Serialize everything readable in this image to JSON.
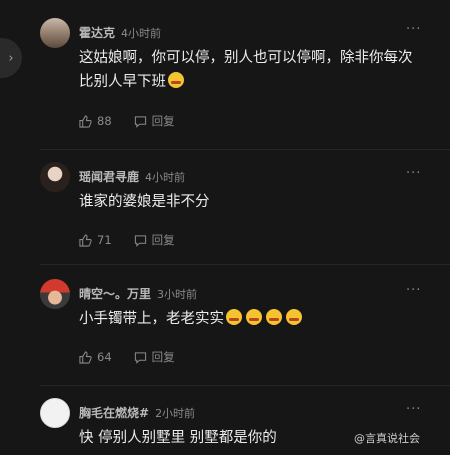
{
  "sidebar": {
    "collapse_icon": "chevron-right-icon"
  },
  "comments": [
    {
      "username": "霍达克",
      "time": "4小时前",
      "text": "这姑娘啊，你可以停，别人也可以停啊，除非你每次比别人早下班",
      "emoji_count": 1,
      "likes": "88",
      "reply_label": "回复",
      "avatar_desc": "avatar-landscape"
    },
    {
      "username": "瑶闻君寻鹿",
      "time": "4小时前",
      "text": "谁家的婆娘是非不分",
      "emoji_count": 0,
      "likes": "71",
      "reply_label": "回复",
      "avatar_desc": "avatar-woman"
    },
    {
      "username": "晴空～。万里",
      "time": "3小时前",
      "text": "小手镯带上，老老实实",
      "emoji_count": 4,
      "likes": "64",
      "reply_label": "回复",
      "avatar_desc": "avatar-person-red-hat"
    },
    {
      "username": "胸毛在燃烧#",
      "time": "2小时前",
      "text": "快 停别人别墅里 别墅都是你的",
      "emoji_count": 0,
      "avatar_desc": "avatar-white"
    }
  ],
  "watermark": "@言真说社会",
  "colors": {
    "background": "#161616",
    "emoji": "#f5c430"
  }
}
